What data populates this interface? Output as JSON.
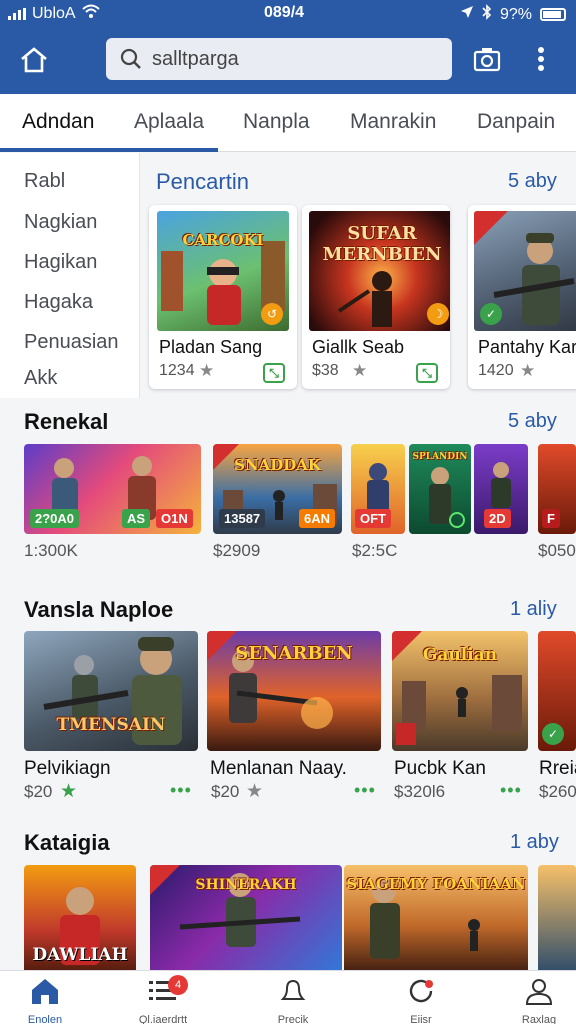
{
  "status": {
    "carrier": "UbloA",
    "time": "089/4",
    "battery": "9?%"
  },
  "search": {
    "placeholder": "salltparga"
  },
  "tabs": [
    "Adndan",
    "Aplaala",
    "Nanpla",
    "Manrakin",
    "Danpain"
  ],
  "sidebar": {
    "items": [
      "Rabl",
      "Nagkian",
      "Hagikan",
      "Hagaka",
      "Penuasian",
      "Akk"
    ]
  },
  "pencartin": {
    "title": "Pencartin",
    "link": "5 aby",
    "cards": [
      {
        "art_title": "CARCOKI",
        "name": "Pladan Sang",
        "count": "1234"
      },
      {
        "art_title": "SUFAR MERNBIEN",
        "name": "Giallk Seab",
        "count": "$38"
      },
      {
        "art_title": "",
        "name": "Pantahy Kar",
        "count": "1420"
      }
    ]
  },
  "renekal": {
    "title": "Renekal",
    "link": "5 aby",
    "thumbs": [
      {
        "tag1": "2?0A0",
        "tag2": "AS",
        "tag3": "O1N",
        "price": "1:300K"
      },
      {
        "art_title": "SNADDAK",
        "tag1": "13587",
        "tag2": "6AN",
        "price": "$2909"
      },
      {
        "tag1": "OFT",
        "price": "$2:5C"
      },
      {
        "art_title": "SPLANDIN",
        "tag1": "",
        "price": ""
      },
      {
        "tag1": "2D",
        "price": ""
      },
      {
        "tag1": "F",
        "price": "$050"
      }
    ]
  },
  "vansla": {
    "title": "Vansla Naploe",
    "link": "1 aliy",
    "cards": [
      {
        "art_title": "TMENSAIN",
        "name": "Pelvikiagn",
        "price": "$20"
      },
      {
        "art_title": "SENARBEN",
        "name": "Menlanan Naay.",
        "price": "$20"
      },
      {
        "art_title": "Gaulian",
        "name": "Pucbk Kan",
        "price": "$320l6"
      },
      {
        "name": "Rreia",
        "price": "$260"
      }
    ]
  },
  "kataigia": {
    "title": "Kataigia",
    "link": "1 aby",
    "cards": [
      {
        "art_title": "DAWLIAH"
      },
      {
        "art_title": "SHINERAKH"
      },
      {
        "art_title": "SIAGEMY FOANIAAN"
      }
    ]
  },
  "bottomnav": {
    "items": [
      "Enolen",
      "Ql.iaerdrtt",
      "Precik",
      "Eiisr",
      "Raxlag"
    ],
    "badge": "4"
  },
  "colors": {
    "accent": "#2a5aa6",
    "green": "#3aa24a",
    "red": "#e53935"
  }
}
